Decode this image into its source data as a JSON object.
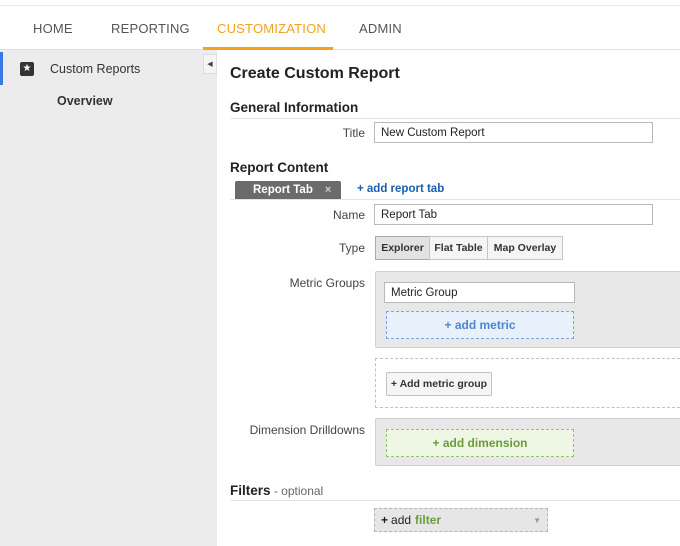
{
  "nav": {
    "items": [
      {
        "label": "HOME"
      },
      {
        "label": "REPORTING"
      },
      {
        "label": "CUSTOMIZATION"
      },
      {
        "label": "ADMIN"
      }
    ],
    "active": "CUSTOMIZATION",
    "accent_color": "#f4a21d"
  },
  "sidebar": {
    "section_label": "Custom Reports",
    "section_icon": "star-icon",
    "overview_label": "Overview",
    "active_bar_color": "#3b78e7",
    "collapse_icon": "chevron-left-icon"
  },
  "main": {
    "title": "Create Custom Report",
    "general": {
      "heading": "General Information",
      "title_label": "Title",
      "title_value": "New Custom Report"
    },
    "content": {
      "heading": "Report Content",
      "tab_label": "Report Tab",
      "tab_close": "×",
      "add_tab_label": "+ add report tab",
      "name_label": "Name",
      "name_value": "Report Tab",
      "type_label": "Type",
      "types": [
        "Explorer",
        "Flat Table",
        "Map Overlay"
      ],
      "selected_type": "Explorer",
      "metric_groups_label": "Metric Groups",
      "metric_group_value": "Metric Group",
      "add_metric_label": "+ add metric",
      "add_metric_group_label": "+ Add metric group",
      "dimension_label": "Dimension Drilldowns",
      "add_dimension_label": "+ add dimension"
    },
    "filters": {
      "heading": "Filters",
      "optional": " - optional",
      "add_plus": "+",
      "add_word": "add",
      "filter_word": "filter"
    }
  }
}
